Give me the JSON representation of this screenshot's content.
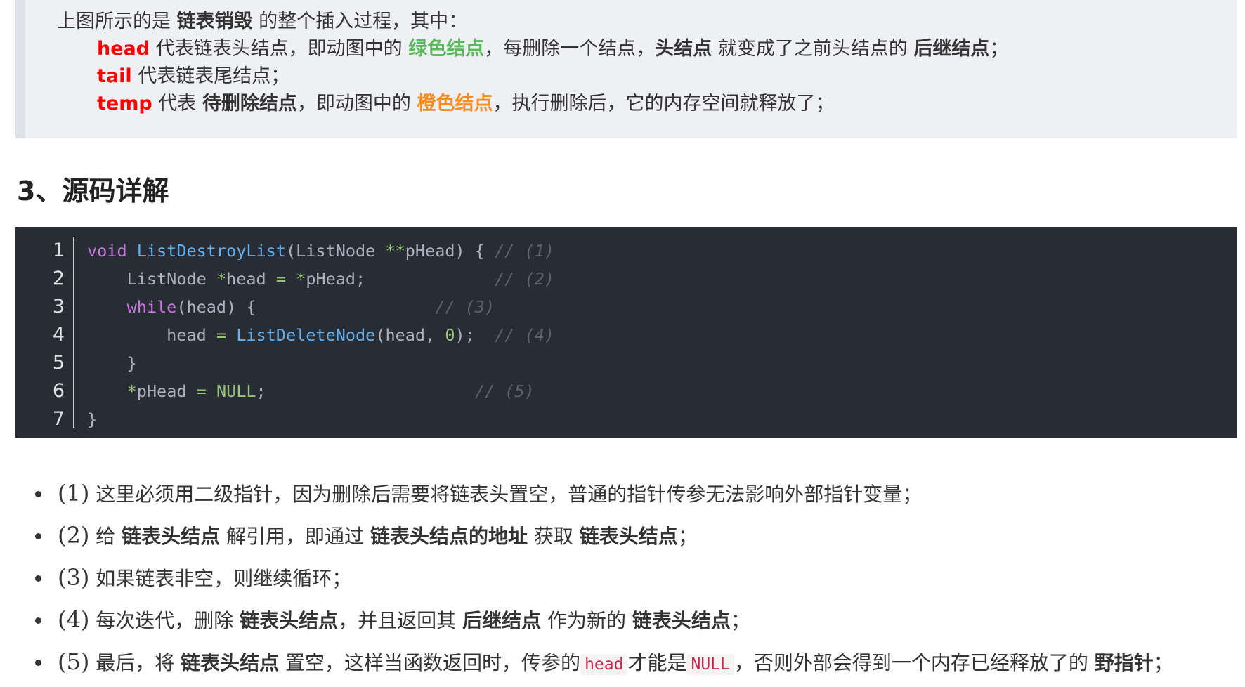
{
  "quote": {
    "line1": {
      "a": "上图所示的是 ",
      "b": "链表销毁",
      "c": " 的整个插入过程，其中："
    },
    "line2": {
      "a": "head",
      "b": " 代表链表头结点，即动图中的 ",
      "c": "绿色结点",
      "d": "，每删除一个结点，",
      "e": "头结点",
      "f": " 就变成了之前头结点的 ",
      "g": "后继结点",
      "h": "；"
    },
    "line3": {
      "a": "tail",
      "b": " 代表链表尾结点；"
    },
    "line4": {
      "a": "temp",
      "b": " 代表 ",
      "c": "待删除结点",
      "d": "，即动图中的 ",
      "e": "橙色结点",
      "f": "，执行删除后，它的内存空间就释放了；"
    }
  },
  "heading": "3、源码详解",
  "code": {
    "line_numbers": [
      "1",
      "2",
      "3",
      "4",
      "5",
      "6",
      "7"
    ],
    "lines": [
      {
        "p1": "void",
        "p2": " ",
        "p3": "ListDestroyList",
        "p4": "(ListNode ",
        "p5": "**",
        "p6": "pHead) { ",
        "p7": "// (1)"
      },
      {
        "p1": "    ListNode ",
        "p2": "*",
        "p3": "head ",
        "p4": "=",
        "p5": " ",
        "p6": "*",
        "p7": "pHead;             ",
        "p8": "// (2)"
      },
      {
        "p1": "    ",
        "p2": "while",
        "p3": "(head) {                  ",
        "p4": "// (3)"
      },
      {
        "p1": "        head ",
        "p2": "=",
        "p3": " ",
        "p4": "ListDeleteNode",
        "p5": "(head, ",
        "p6": "0",
        "p7": ");  ",
        "p8": "// (4)"
      },
      {
        "p1": "    }"
      },
      {
        "p1": "    ",
        "p2": "*",
        "p3": "pHead ",
        "p4": "=",
        "p5": " ",
        "p6": "NULL",
        "p7": ";                     ",
        "p8": "// (5)"
      },
      {
        "p1": "}"
      }
    ]
  },
  "bullets": [
    {
      "num": "(1)",
      "a": " 这里必须用二级指针，因为删除后需要将链表头置空，普通的指针传参无法影响外部指针变量；"
    },
    {
      "num": "(2)",
      "a": " 给 ",
      "b": "链表头结点",
      "c": " 解引用，即通过 ",
      "d": "链表头结点的地址",
      "e": " 获取 ",
      "f": "链表头结点",
      "g": "；"
    },
    {
      "num": "(3)",
      "a": " 如果链表非空，则继续循环；"
    },
    {
      "num": "(4)",
      "a": " 每次迭代，删除 ",
      "b": "链表头结点",
      "c": "，并且返回其 ",
      "d": "后继结点",
      "e": " 作为新的 ",
      "f": "链表头结点",
      "g": "；"
    },
    {
      "num": "(5)",
      "a": " 最后，将 ",
      "b": "链表头结点",
      "c": " 置空，这样当函数返回时，传参的",
      "d": "head",
      "e": "才能是",
      "f": "NULL",
      "g": "，否则外部会得到一个内存已经释放了的 ",
      "h": "野指针",
      "i": "；"
    }
  ],
  "colors": {
    "red": "#ff0000",
    "green": "#5cb85c",
    "orange": "#ff8c1a",
    "code_bg": "#282c34",
    "quote_bg": "#eef0f4"
  }
}
